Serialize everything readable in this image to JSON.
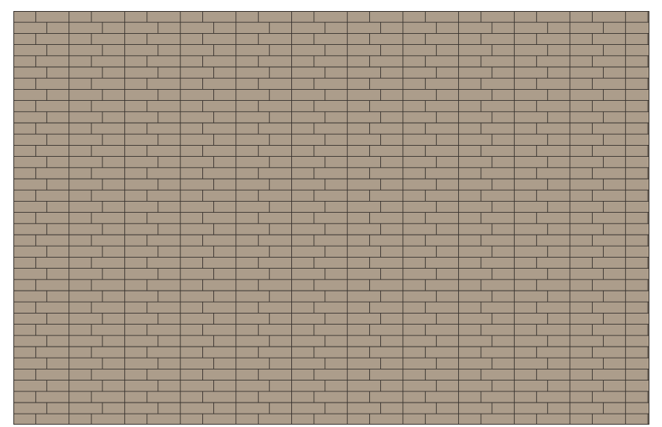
{
  "pattern": {
    "name": "brick-tile-pattern",
    "colors": {
      "tile": "#ac9d8b",
      "grout": "#3a3530",
      "background": "#ffffff"
    }
  }
}
